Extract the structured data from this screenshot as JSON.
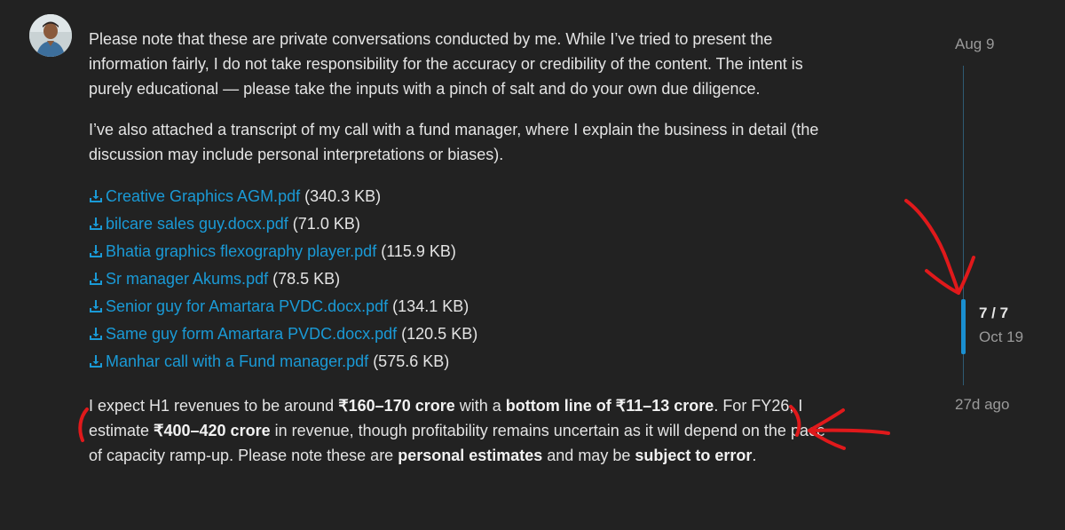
{
  "post": {
    "paragraphs": {
      "disclaimer": "Please note that these are private conversations conducted by me. While I’ve tried to present the information fairly, I do not take responsibility for the accuracy or credibility of the content. The intent is purely educational — please take the inputs with a pinch of salt and do your own due diligence.",
      "transcript_note": "I’ve also attached a transcript of my call with a fund manager, where I explain the business in detail (the discussion may include personal interpretations or biases)."
    },
    "attachments": [
      {
        "name": "Creative Graphics AGM.pdf",
        "size": "(340.3 KB)"
      },
      {
        "name": "bilcare sales guy.docx.pdf",
        "size": "(71.0 KB)"
      },
      {
        "name": "Bhatia graphics flexography player.pdf",
        "size": "(115.9 KB)"
      },
      {
        "name": "Sr manager Akums.pdf",
        "size": "(78.5 KB)"
      },
      {
        "name": "Senior guy for Amartara PVDC.docx.pdf",
        "size": "(134.1 KB)"
      },
      {
        "name": "Same guy form Amartara PVDC.docx.pdf",
        "size": "(120.5 KB)"
      },
      {
        "name": "Manhar call with a Fund manager.pdf",
        "size": "(575.6 KB)"
      }
    ],
    "estimate": {
      "t1": "I expect H1 revenues to be around ",
      "b1": "₹160–170 crore",
      "t2": " with a ",
      "b2": "bottom line of ₹11–13 crore",
      "t3": ". For FY26, I estimate ",
      "b3": "₹400–420 crore",
      "t4": " in revenue, though profitability remains uncertain as it will depend on the pace of capacity ramp-up. Please note these are ",
      "b4": "personal estimates",
      "t5": " and may be ",
      "b5": "subject to error",
      "t6": "."
    }
  },
  "timeline": {
    "start_date": "Aug 9",
    "position": "7 / 7",
    "current_date": "Oct 19",
    "end_label": "27d ago"
  },
  "icons": {
    "download": "download-icon",
    "avatar": "user-avatar"
  },
  "colors": {
    "background": "#222222",
    "link": "#1a9ad6",
    "timeline_accent": "#1a8fd0",
    "annotation": "#e0191b"
  }
}
